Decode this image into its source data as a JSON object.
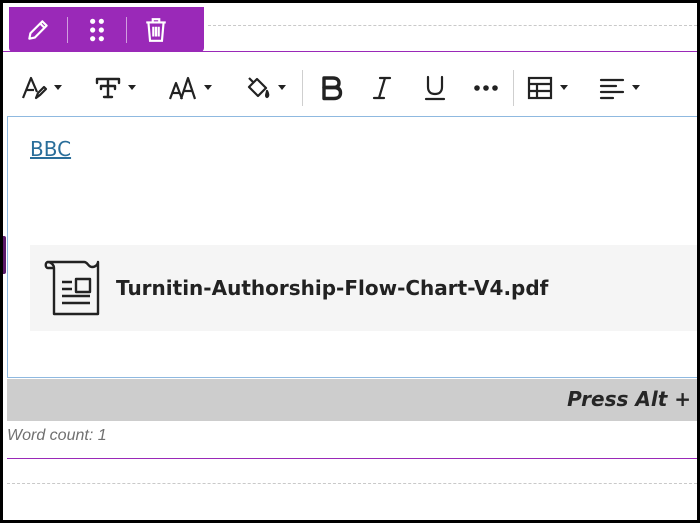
{
  "block_toolbar": {
    "icons": [
      "pencil-icon",
      "drag-handle-icon",
      "trash-icon"
    ],
    "color": "#9a29b8"
  },
  "format_toolbar": {
    "items": [
      "text-style-icon",
      "font-icon",
      "font-size-icon",
      "paint-bucket-icon",
      "bold-icon",
      "italic-icon",
      "underline-icon",
      "more-icon",
      "table-icon",
      "align-left-icon"
    ]
  },
  "editor": {
    "link_text": "BBC",
    "attachment": {
      "file_name": "Turnitin-Authorship-Flow-Chart-V4.pdf",
      "icon": "document-icon"
    }
  },
  "status": {
    "hint": "Press Alt +",
    "word_count": "Word count: 1"
  },
  "colors": {
    "accent": "#9a29b8",
    "link": "#2a6e9a",
    "focus_border": "#8fb9e0",
    "status_bg": "#cdcdcd"
  }
}
